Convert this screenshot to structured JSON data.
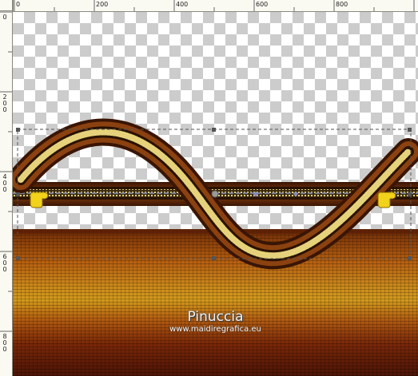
{
  "ruler": {
    "top_labels": [
      "0",
      "200",
      "400",
      "600",
      "800"
    ],
    "left_labels": [
      "0",
      "2\n0\n0",
      "4\n0\n0",
      "6\n0\n0",
      "8\n0\n0"
    ]
  },
  "watermark": {
    "title": "Pinuccia",
    "url": "www.maidiregrafica.eu"
  },
  "icons": [
    "pointing-hand-icon",
    "pointing-hand-icon"
  ],
  "colors": {
    "floor_orange": "#c9861a",
    "floor_dark": "#4d1406",
    "band_brown": "#6a2c08",
    "selection_border": "#555555"
  }
}
